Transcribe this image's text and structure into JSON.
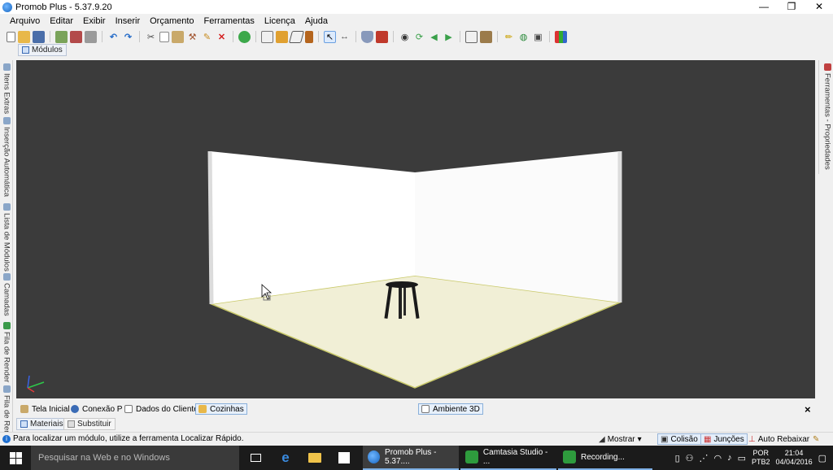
{
  "window": {
    "title": "Promob Plus - 5.37.9.20",
    "controls": [
      "—",
      "❐",
      "✕"
    ]
  },
  "menu": [
    "Arquivo",
    "Editar",
    "Exibir",
    "Inserir",
    "Orçamento",
    "Ferramentas",
    "Licença",
    "Ajuda"
  ],
  "toolbar_icons": [
    "new-icon",
    "open-icon",
    "save-icon",
    "print-icon",
    "export-icon",
    "render-icon",
    "undo-icon",
    "redo-icon",
    "cut-icon",
    "copy-icon",
    "paste-icon",
    "hammer-icon",
    "brush-icon",
    "delete-icon",
    "globe-icon",
    "layout-icon",
    "stack-icon",
    "shape-icon",
    "door-icon",
    "select-icon",
    "measure-icon",
    "shield-icon",
    "book-icon",
    "eye-icon",
    "rotate-icon",
    "arrow-left-icon",
    "arrow-right-icon",
    "view-icon",
    "cube-icon",
    "pencil-icon",
    "camera-icon",
    "snapshot-icon",
    "grid-icon"
  ],
  "modules_tab": "Módulos",
  "left_tabs": [
    "Itens Extras",
    "Inserção Automática",
    "Lista de Módulos",
    "Camadas",
    "Fila de Render",
    "Fila de Ren"
  ],
  "right_tabs": [
    "Ferramentas - Propriedades"
  ],
  "bottom_tabs": [
    "Tela Inicial",
    "Conexão P",
    "Dados do Cliente",
    "Cozinhas"
  ],
  "center_tab": "Ambiente 3D",
  "close_glyph": "×",
  "lower_tabs": [
    "Materiais",
    "Substituir"
  ],
  "status": {
    "message": "Para localizar um módulo, utilize a ferramenta Localizar Rápido.",
    "mostrar": "Mostrar",
    "colisao": "Colisão",
    "juncoes": "Junções",
    "auto_rebaixar": "Auto Rebaixar"
  },
  "taskbar": {
    "search_placeholder": "Pesquisar na Web e no Windows",
    "tasks": [
      "Promob Plus - 5.37....",
      "Camtasia Studio - ...",
      "Recording..."
    ],
    "lang": "POR",
    "layout": "PTB2",
    "time": "21:04",
    "date": "04/04/2016"
  },
  "colors": {
    "viewport_bg": "#3b3b3b",
    "wall": "#ffffff",
    "floor": "#f2f0da",
    "accent": "#1f6fd0",
    "taskbar": "#1b1b1b"
  }
}
